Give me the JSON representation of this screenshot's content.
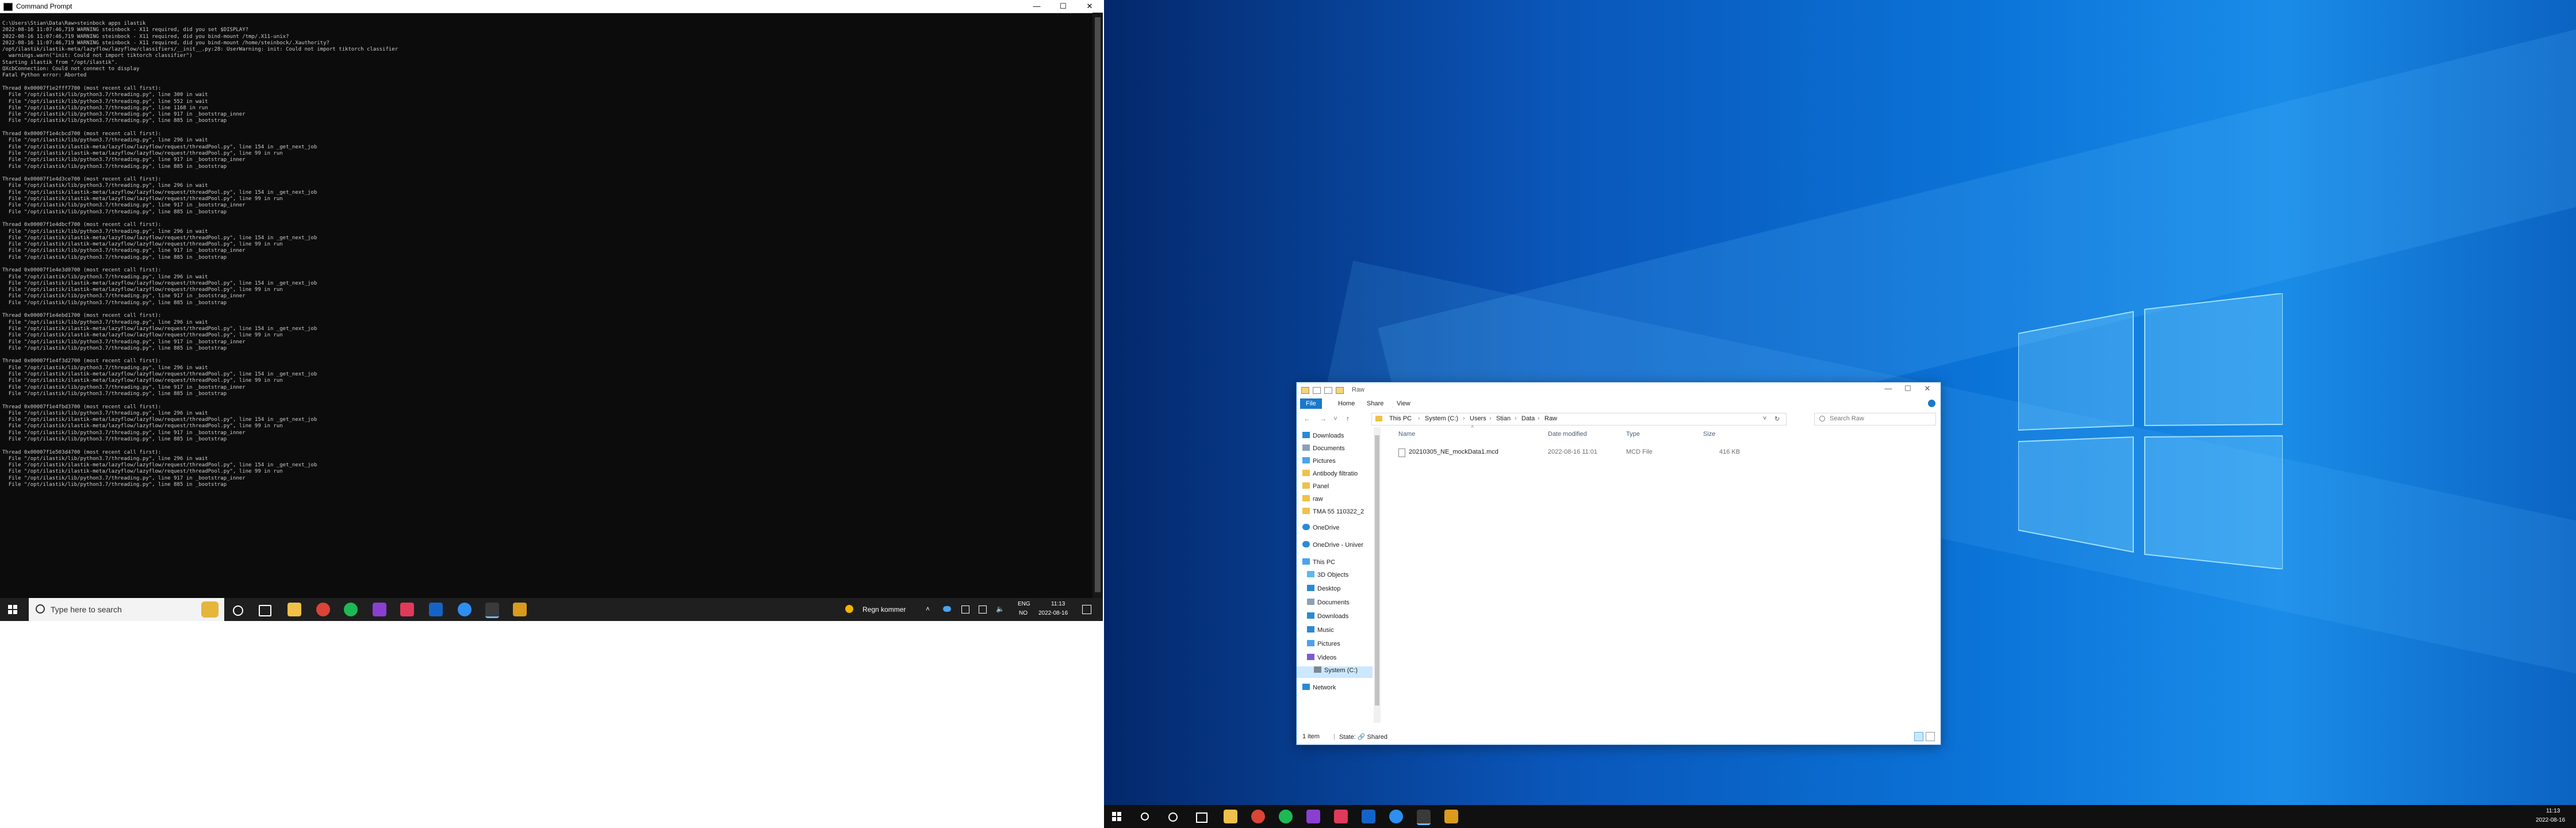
{
  "cmd": {
    "title": "Command Prompt",
    "controls": {
      "minimize": "—",
      "maximize": "☐",
      "close": "✕"
    },
    "output": "C:\\Users\\Stian\\Data\\Raw>steinbock apps ilastik\n2022-08-16 11:07:46,719 WARNING steinbock - X11 required, did you set $DISPLAY?\n2022-08-16 11:07:46,719 WARNING steinbock - X11 required, did you bind-mount /tmp/.X11-unix?\n2022-08-16 11:07:46,719 WARNING steinbock - X11 required, did you bind-mount /home/steinbock/.Xauthority?\n/opt/ilastik/ilastik-meta/lazyflow/lazyflow/classifiers/__init__.py:28: UserWarning: init: Could not import tiktorch classifier\n  warnings.warn(\"init: Could not import tiktorch classifier\")\nStarting ilastik from \"/opt/ilastik\".\nQXcbConnection: Could not connect to display\nFatal Python error: Aborted\n\nThread 0x00007f1e2fff7700 (most recent call first):\n  File \"/opt/ilastik/lib/python3.7/threading.py\", line 300 in wait\n  File \"/opt/ilastik/lib/python3.7/threading.py\", line 552 in wait\n  File \"/opt/ilastik/lib/python3.7/threading.py\", line 1168 in run\n  File \"/opt/ilastik/lib/python3.7/threading.py\", line 917 in _bootstrap_inner\n  File \"/opt/ilastik/lib/python3.7/threading.py\", line 885 in _bootstrap\n\nThread 0x00007f1e4cbcd700 (most recent call first):\n  File \"/opt/ilastik/lib/python3.7/threading.py\", line 296 in wait\n  File \"/opt/ilastik/ilastik-meta/lazyflow/lazyflow/request/threadPool.py\", line 154 in _get_next_job\n  File \"/opt/ilastik/ilastik-meta/lazyflow/lazyflow/request/threadPool.py\", line 99 in run\n  File \"/opt/ilastik/lib/python3.7/threading.py\", line 917 in _bootstrap_inner\n  File \"/opt/ilastik/lib/python3.7/threading.py\", line 885 in _bootstrap\n\nThread 0x00007f1e4d3ce700 (most recent call first):\n  File \"/opt/ilastik/lib/python3.7/threading.py\", line 296 in wait\n  File \"/opt/ilastik/ilastik-meta/lazyflow/lazyflow/request/threadPool.py\", line 154 in _get_next_job\n  File \"/opt/ilastik/ilastik-meta/lazyflow/lazyflow/request/threadPool.py\", line 99 in run\n  File \"/opt/ilastik/lib/python3.7/threading.py\", line 917 in _bootstrap_inner\n  File \"/opt/ilastik/lib/python3.7/threading.py\", line 885 in _bootstrap\n\nThread 0x00007f1e4dbcf700 (most recent call first):\n  File \"/opt/ilastik/lib/python3.7/threading.py\", line 296 in wait\n  File \"/opt/ilastik/ilastik-meta/lazyflow/lazyflow/request/threadPool.py\", line 154 in _get_next_job\n  File \"/opt/ilastik/ilastik-meta/lazyflow/lazyflow/request/threadPool.py\", line 99 in run\n  File \"/opt/ilastik/lib/python3.7/threading.py\", line 917 in _bootstrap_inner\n  File \"/opt/ilastik/lib/python3.7/threading.py\", line 885 in _bootstrap\n\nThread 0x00007f1e4e3d0700 (most recent call first):\n  File \"/opt/ilastik/lib/python3.7/threading.py\", line 296 in wait\n  File \"/opt/ilastik/ilastik-meta/lazyflow/lazyflow/request/threadPool.py\", line 154 in _get_next_job\n  File \"/opt/ilastik/ilastik-meta/lazyflow/lazyflow/request/threadPool.py\", line 99 in run\n  File \"/opt/ilastik/lib/python3.7/threading.py\", line 917 in _bootstrap_inner\n  File \"/opt/ilastik/lib/python3.7/threading.py\", line 885 in _bootstrap\n\nThread 0x00007f1e4ebd1700 (most recent call first):\n  File \"/opt/ilastik/lib/python3.7/threading.py\", line 296 in wait\n  File \"/opt/ilastik/ilastik-meta/lazyflow/lazyflow/request/threadPool.py\", line 154 in _get_next_job\n  File \"/opt/ilastik/ilastik-meta/lazyflow/lazyflow/request/threadPool.py\", line 99 in run\n  File \"/opt/ilastik/lib/python3.7/threading.py\", line 917 in _bootstrap_inner\n  File \"/opt/ilastik/lib/python3.7/threading.py\", line 885 in _bootstrap\n\nThread 0x00007f1e4f3d2700 (most recent call first):\n  File \"/opt/ilastik/lib/python3.7/threading.py\", line 296 in wait\n  File \"/opt/ilastik/ilastik-meta/lazyflow/lazyflow/request/threadPool.py\", line 154 in _get_next_job\n  File \"/opt/ilastik/ilastik-meta/lazyflow/lazyflow/request/threadPool.py\", line 99 in run\n  File \"/opt/ilastik/lib/python3.7/threading.py\", line 917 in _bootstrap_inner\n  File \"/opt/ilastik/lib/python3.7/threading.py\", line 885 in _bootstrap\n\nThread 0x00007f1e4fbd3700 (most recent call first):\n  File \"/opt/ilastik/lib/python3.7/threading.py\", line 296 in wait\n  File \"/opt/ilastik/ilastik-meta/lazyflow/lazyflow/request/threadPool.py\", line 154 in _get_next_job\n  File \"/opt/ilastik/ilastik-meta/lazyflow/lazyflow/request/threadPool.py\", line 99 in run\n  File \"/opt/ilastik/lib/python3.7/threading.py\", line 917 in _bootstrap_inner\n  File \"/opt/ilastik/lib/python3.7/threading.py\", line 885 in _bootstrap\n\nThread 0x00007f1e503d4700 (most recent call first):\n  File \"/opt/ilastik/lib/python3.7/threading.py\", line 296 in wait\n  File \"/opt/ilastik/ilastik-meta/lazyflow/lazyflow/request/threadPool.py\", line 154 in _get_next_job\n  File \"/opt/ilastik/ilastik-meta/lazyflow/lazyflow/request/threadPool.py\", line 99 in run\n  File \"/opt/ilastik/lib/python3.7/threading.py\", line 917 in _bootstrap_inner\n  File \"/opt/ilastik/lib/python3.7/threading.py\", line 885 in _bootstrap"
  },
  "taskbar_left": {
    "search_placeholder": "Type here to search",
    "weather": "Regn kommer",
    "lang_line1": "ENG",
    "lang_line2": "NO",
    "time": "11:13",
    "date": "2022-08-16"
  },
  "explorer": {
    "title": "Raw",
    "tabs": [
      "File",
      "Home",
      "Share",
      "View"
    ],
    "breadcrumb": [
      "This PC",
      "System (C:)",
      "Users",
      "Stian",
      "Data",
      "Raw"
    ],
    "search_placeholder": "Search Raw",
    "nav_items": [
      "Downloads",
      "Documents",
      "Pictures",
      "Antibody filtratio",
      "Panel",
      "raw",
      "TMA 55 110322_2",
      "OneDrive",
      "OneDrive - Univer",
      "This PC",
      "3D Objects",
      "Desktop",
      "Documents",
      "Downloads",
      "Music",
      "Pictures",
      "Videos",
      "System (C:)",
      "Network"
    ],
    "columns": {
      "name": "Name",
      "date": "Date modified",
      "type": "Type",
      "size": "Size"
    },
    "files": [
      {
        "name": "20210305_NE_mockData1.mcd",
        "date": "2022-08-16 11:01",
        "type": "MCD File",
        "size": "416 KB"
      }
    ],
    "status_count": "1 item",
    "status_state": "State: 🔗 Shared"
  },
  "taskbar_right": {
    "time": "11:13",
    "date": "2022-08-16"
  },
  "colors": {
    "cmd_bg": "#0c0c0c",
    "cmd_text": "#cccccc",
    "taskbar": "#1f1f1f",
    "accent": "#1979ca",
    "desktop": "#0b74d8"
  }
}
